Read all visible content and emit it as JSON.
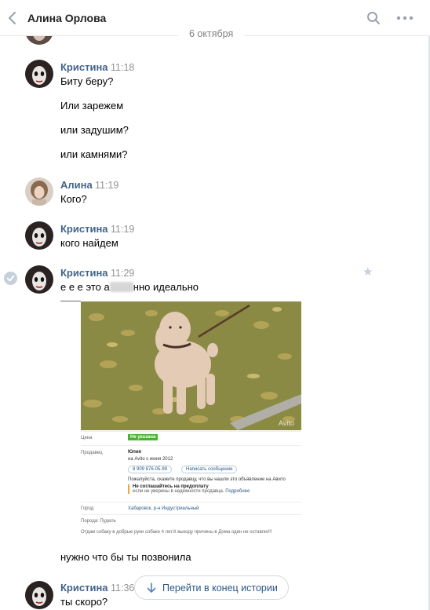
{
  "header": {
    "title": "Алина Орлова"
  },
  "date_separator": "6 октября",
  "messages": [
    {
      "author": "Кристина",
      "time": "11:18",
      "lines": [
        "Биту беру?",
        "Или зарежем",
        "или задушим?",
        "или камнями?"
      ]
    },
    {
      "author": "Алина",
      "time": "11:19",
      "lines": [
        "Кого?"
      ]
    },
    {
      "author": "Кристина",
      "time": "11:19",
      "lines": [
        "кого найдем"
      ]
    },
    {
      "author": "Кристина",
      "time": "11:29",
      "text_before_blur": "е е е это а",
      "text_after_blur": "нно идеально"
    },
    {
      "text": "нужно что бы ты позвонила"
    },
    {
      "author": "Кристина",
      "time": "11:36",
      "lines": [
        "ты скоро?"
      ]
    }
  ],
  "listing": {
    "price_label": "Цена",
    "price_value": "Не указана",
    "seller_label": "Продавец",
    "seller_name": "Юлия",
    "seller_since": "на Avito с июня 2012",
    "phone": "8 909 876-05-99",
    "message_button": "Написать сообщение",
    "notice": "Пожалуйста, скажите продавцу, что вы нашли это объявление на Авито",
    "warn_title": "Не соглашайтесь на предоплату",
    "warn_text": "если не уверены в надежности продавца.",
    "warn_link": "Подробнее",
    "city_label": "Город",
    "city_value": "Хабаровск, р-н Индустриальный",
    "breed": "Порода: Пудель",
    "description": "Отдам собаку в добрые руки собаке 4 лет.К выезду причины в Дома один не оставлю!!!",
    "watermark": "Avito"
  },
  "scroll_button": {
    "label": "Перейти в конец истории"
  },
  "colors": {
    "link": "#2a5885",
    "author": "#42648b",
    "muted": "#939393",
    "price_badge": "#4caf36"
  },
  "icons": [
    "back-chevron-icon",
    "search-icon",
    "more-dots-icon",
    "read-check-icon",
    "star-icon",
    "arrow-down-icon"
  ]
}
